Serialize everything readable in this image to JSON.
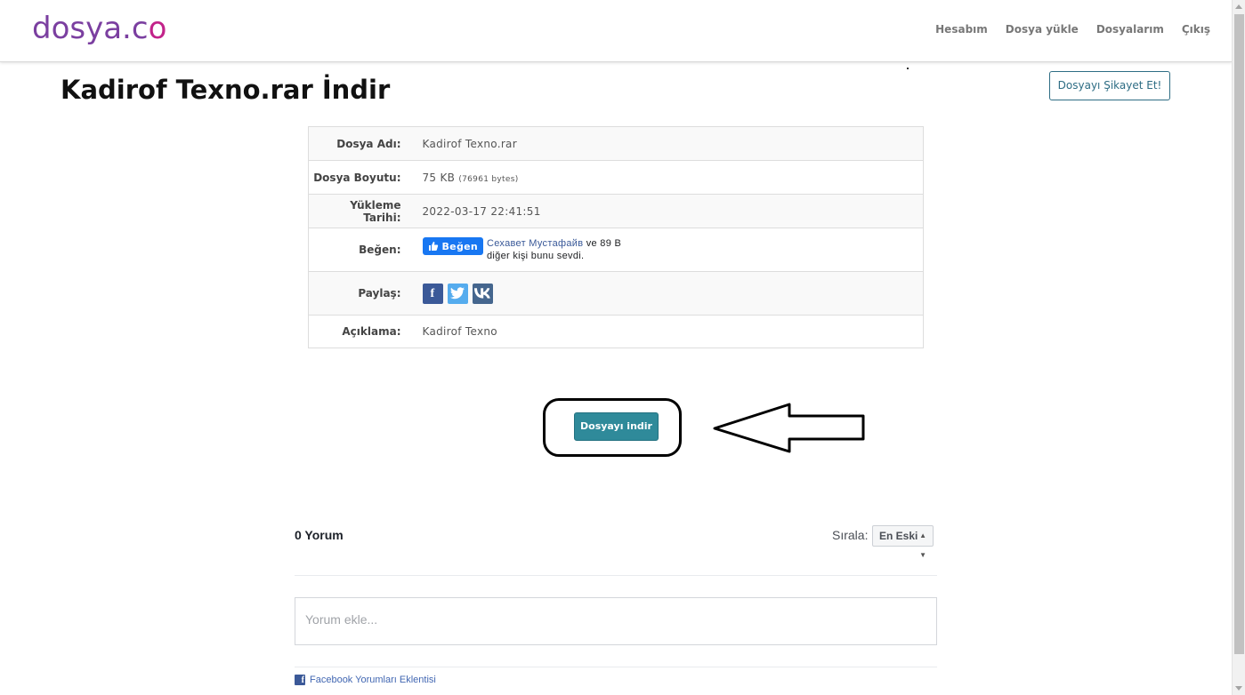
{
  "header": {
    "logo_part1": "dosya.c",
    "logo_part2": "o",
    "nav": [
      "Hesabım",
      "Dosya yükle",
      "Dosyalarım",
      "Çıkış"
    ]
  },
  "page": {
    "title": "Kadirof Texno.rar İndir",
    "complain_label": "Dosyayı Şikayet Et!"
  },
  "file_info": {
    "name_label": "Dosya Adı:",
    "name_value": "Kadirof Texno.rar",
    "size_label": "Dosya Boyutu:",
    "size_value": "75 KB",
    "size_bytes": "(76961 bytes)",
    "date_label": "Yükleme Tarihi:",
    "date_value": "2022-03-17 22:41:51",
    "like_label": "Beğen:",
    "like_button": "Beğen",
    "like_name": "Сехавет Мустафайв",
    "like_rest": " ve 89 B",
    "like_line2": "diğer kişi bunu sevdi.",
    "share_label": "Paylaş:",
    "desc_label": "Açıklama:",
    "desc_value": "Kadirof Texno"
  },
  "download": {
    "label": "Dosyayı indir"
  },
  "comments": {
    "count": "0 Yorum",
    "sort_label": "Sırala:",
    "sort_value": "En Eski",
    "placeholder": "Yorum ekle...",
    "plugin": "Facebook Yorumları Eklentisi"
  },
  "icons": {
    "share": [
      "facebook-icon",
      "twitter-icon",
      "vk-icon"
    ],
    "annotation": "arrow-icon"
  },
  "colors": {
    "logo_purple": "#7b3fa0",
    "logo_pink": "#c2238a",
    "download_button": "#2f8a9a",
    "complain_border": "#2e6d84",
    "facebook_blue": "#1877f2"
  }
}
